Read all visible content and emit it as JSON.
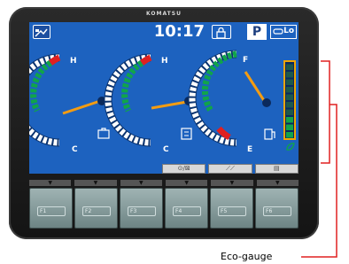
{
  "brand": "KOMATSU",
  "status_bar": {
    "time": "10:17",
    "gear": "P",
    "speed_label": "Lo",
    "icons": [
      "attachment-mode-icon",
      "lock-icon",
      "travel-speed-icon"
    ]
  },
  "gauges": [
    {
      "name": "coolant-temperature-gauge",
      "high_label": "H",
      "low_label": "C",
      "level": 0.55,
      "icon": "engine-coolant-icon"
    },
    {
      "name": "hydraulic-oil-temperature-gauge",
      "high_label": "H",
      "low_label": "C",
      "level": 0.5,
      "icon": "hydraulic-oil-icon"
    },
    {
      "name": "fuel-gauge",
      "high_label": "F",
      "low_label": "E",
      "level": 0.85,
      "icon": "fuel-pump-icon"
    }
  ],
  "eco_gauge": {
    "level": 0.3,
    "icon": "eco-leaf-icon"
  },
  "mode_buttons": [
    {
      "text": "⊙/⊠",
      "icon": "working-mode-icon"
    },
    {
      "text": "⟋⟋",
      "icon": "wiper-icon"
    },
    {
      "text": "▤",
      "icon": "menu-icon"
    }
  ],
  "function_keys": [
    {
      "label": "F1",
      "arrow": "▼"
    },
    {
      "label": "F2",
      "arrow": "▼"
    },
    {
      "label": "F3",
      "arrow": "▼"
    },
    {
      "label": "F4",
      "arrow": "▼"
    },
    {
      "label": "F5",
      "arrow": "▼"
    },
    {
      "label": "F6",
      "arrow": "▼"
    }
  ],
  "callout": {
    "label": "Eco-gauge"
  },
  "colors": {
    "screen_bg": "#1d62bf",
    "needle": "#f39c12",
    "green": "#10a44a",
    "red": "#e02020",
    "eco_amber": "#f0a500"
  }
}
